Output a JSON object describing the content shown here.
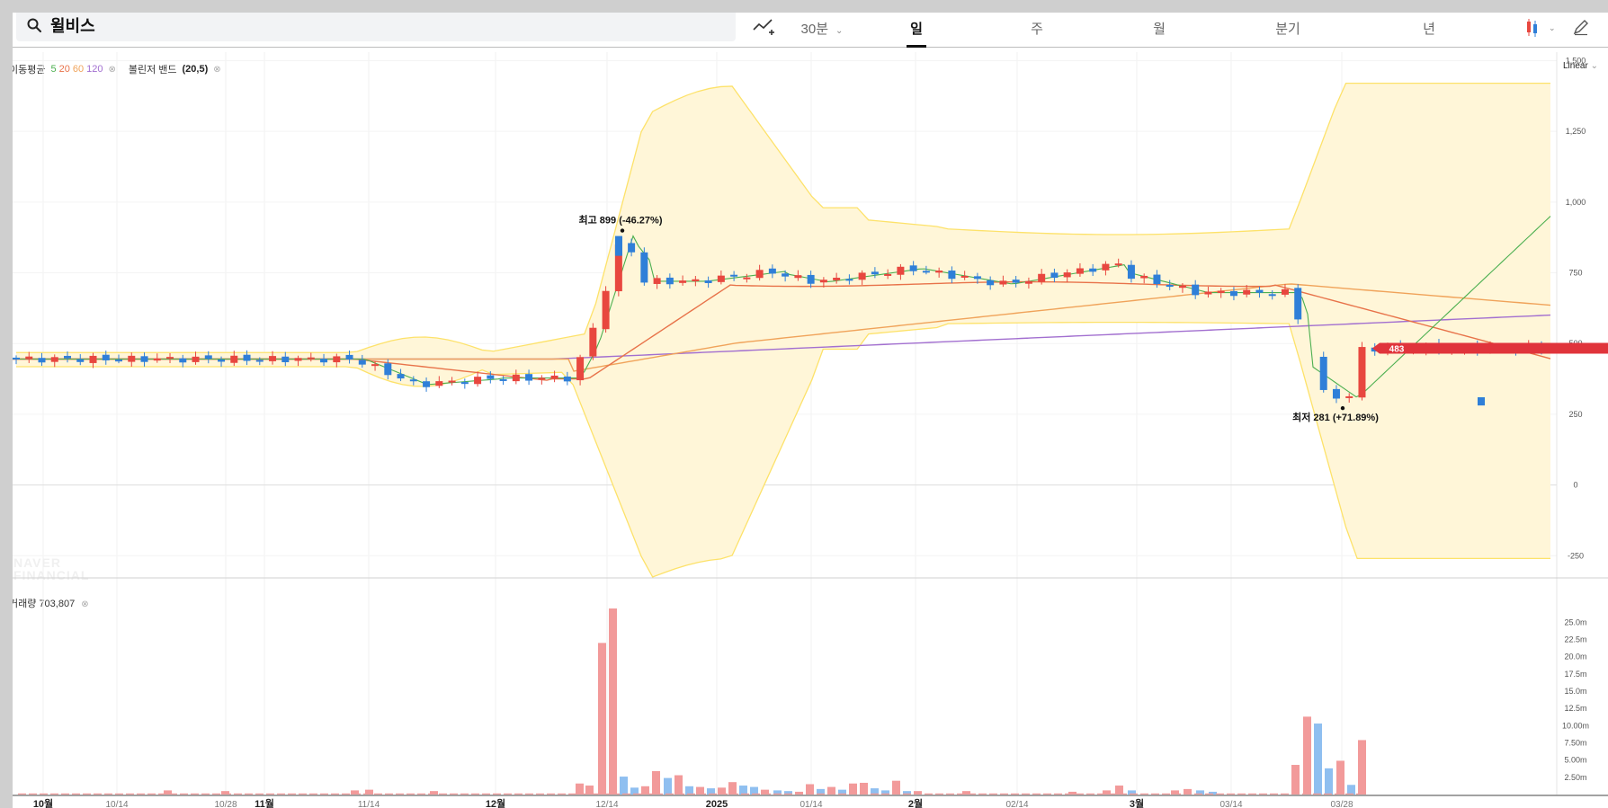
{
  "search": {
    "query": "윌비스"
  },
  "toolbar": {
    "tabs": [
      {
        "label": "30분",
        "active": false,
        "dropdown": true
      },
      {
        "label": "일",
        "active": true
      },
      {
        "label": "주",
        "active": false
      },
      {
        "label": "월",
        "active": false
      },
      {
        "label": "분기",
        "active": false
      },
      {
        "label": "년",
        "active": false
      }
    ],
    "icons": [
      "draw-tool-icon",
      "candle-type-icon",
      "pen-icon",
      "search-icon"
    ]
  },
  "indicators": {
    "ma_label": "이동평균",
    "ma_periods": [
      "5",
      "20",
      "60",
      "120"
    ],
    "bollinger_label": "볼린저 밴드",
    "bollinger_params": "(20,5)"
  },
  "scale_label": "Linear",
  "volume": {
    "label": "거래량",
    "value": "703,807"
  },
  "watermark": [
    "NAVER",
    "FINANCIAL"
  ],
  "colors": {
    "up": "#e8473f",
    "down": "#2f7fd8",
    "ma5": "#4caf50",
    "ma20": "#e8734a",
    "ma60": "#f0a35a",
    "ma120": "#a26fd0",
    "band": "#fde26a",
    "current": "#e0343b"
  },
  "chart_data": {
    "type": "candlestick",
    "x_labels": [
      "10월",
      "10/14",
      "10/28",
      "11월",
      "11/14",
      "12월",
      "12/14",
      "2025",
      "01/14",
      "2월",
      "02/14",
      "3월",
      "03/14",
      "03/28"
    ],
    "price_axis": {
      "ticks": [
        "1,500",
        "1,250",
        "1,000",
        "750",
        "500",
        "250",
        "0",
        "-250"
      ],
      "ylim": [
        -300,
        1530
      ]
    },
    "volume_axis": {
      "ticks": [
        "25.0m",
        "22.5m",
        "20.0m",
        "17.5m",
        "15.0m",
        "12.5m",
        "10.00m",
        "7.50m",
        "5.00m",
        "2.50m"
      ]
    },
    "current_price": "483",
    "annotations": [
      {
        "text": "최고 899 (-46.27%)",
        "value": 899
      },
      {
        "text": "최저 281 (+71.89%)",
        "value": 281
      }
    ],
    "close": [
      453,
      450,
      452,
      449,
      448,
      447,
      449,
      451,
      446,
      444,
      446,
      450,
      448,
      446,
      449,
      451,
      453,
      450,
      448,
      446,
      449,
      452,
      447,
      445,
      449,
      452,
      448,
      446,
      444,
      440,
      430,
      420,
      405,
      398,
      392,
      385,
      378,
      372,
      365,
      358,
      354,
      352,
      356,
      362,
      367,
      372,
      369,
      371,
      374,
      376,
      379,
      382,
      385,
      384,
      380,
      383,
      386,
      389,
      392,
      395,
      398,
      402,
      406,
      411,
      417,
      424,
      432,
      440,
      448,
      456,
      465,
      474,
      483,
      492,
      500,
      510,
      520,
      530,
      535,
      540,
      545,
      548,
      552,
      554,
      556,
      558,
      560,
      562,
      563,
      564,
      565,
      566,
      567,
      568,
      569,
      570,
      571,
      572,
      573,
      574,
      575,
      576,
      577,
      578,
      579,
      580,
      580,
      581,
      582,
      583,
      583,
      584,
      585,
      586,
      586,
      587,
      588,
      588,
      589,
      589,
      590,
      590,
      591,
      592,
      592,
      593,
      593,
      594,
      594,
      595,
      595,
      596,
      596,
      597,
      597,
      598
    ],
    "volume_m": [
      0.1,
      0.1,
      0.1,
      0.1,
      0.1,
      0.1,
      0.1,
      0.1,
      0.1,
      0.1,
      0.1,
      0.1,
      0.1,
      0.1,
      0.2,
      0.1,
      0.1,
      0.1,
      0.1,
      0.1,
      0.1,
      0.2,
      0.1,
      0.1,
      0.1,
      0.1,
      0.1,
      0.1,
      0.1,
      0.1,
      0.1,
      0.1,
      0.1,
      0.1,
      0.1,
      0.1,
      0.2,
      0.1,
      0.1,
      0.1,
      0.1,
      0.1,
      0.1,
      0.1,
      0.1,
      0.1,
      0.1,
      0.1,
      0.1,
      0.1,
      0.1,
      0.1,
      0.1,
      0.1,
      0.1,
      0.1,
      0.1,
      0.1,
      0.1,
      0.1,
      0.1,
      0.1,
      0.1,
      0.1,
      0.1,
      0.1,
      0.1,
      0.1,
      0.1,
      0.1,
      0.1,
      0.1,
      0.1,
      0.1,
      0.1,
      0.1,
      0.1,
      0.1,
      0.1,
      0.1,
      0.1,
      0.1,
      0.1,
      0.1,
      0.1,
      0.1,
      0.1,
      0.1,
      0.1,
      0.1,
      0.1,
      0.1,
      0.1,
      0.1,
      0.1,
      0.1,
      0.1,
      0.1,
      0.1,
      0.1,
      0.1,
      0.1,
      0.1,
      0.1,
      0.1,
      0.1,
      0.1,
      0.1,
      0.1,
      0.1,
      0.1,
      0.1,
      0.1,
      0.1,
      0.1,
      0.1,
      0.1,
      0.1,
      0.1,
      0.1,
      0.1,
      0.1,
      0.1,
      0.1,
      0.1,
      0.1,
      0.1,
      0.1,
      0.1,
      0.1,
      0.1,
      0.1,
      0.1,
      0.1,
      0.1,
      0.1,
      0.1
    ]
  }
}
